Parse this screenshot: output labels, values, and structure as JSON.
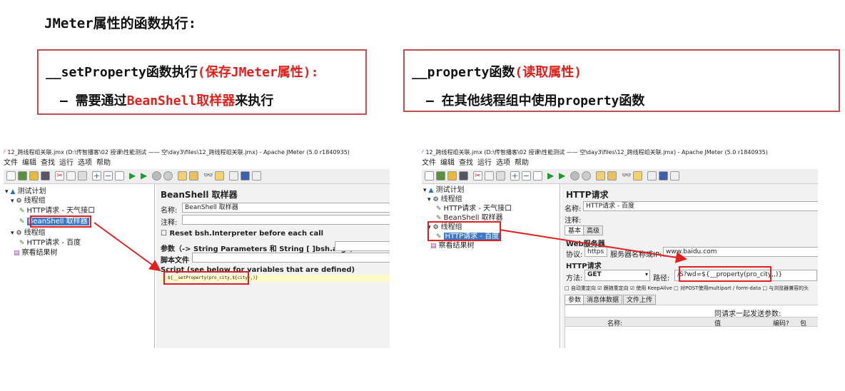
{
  "heading": "JMeter属性的函数执行:",
  "callout_left": {
    "line1_fn": "__setProperty函数执行",
    "line1_note": "(保存JMeter属性):",
    "line2_prefix": "— 需要通过",
    "line2_highlight": "BeanShell取样器",
    "line2_suffix": "来执行"
  },
  "callout_right": {
    "line1_fn": "__property函数",
    "line1_note": "(读取属性)",
    "line2": "— 在其他线程组中使用property函数"
  },
  "colors": {
    "callout_border": "#c0504d",
    "highlight_red": "#e0201b",
    "selection_blue": "#3c79c7"
  },
  "left_shot": {
    "title": "12_跨线程组关联.jmx (D:\\传智播客\\02 授课\\性能测试 —— 空\\day3\\files\\12_跨线程组关联.jmx) - Apache JMeter (5.0 r1840935)",
    "menu": [
      "文件",
      "编辑",
      "查找",
      "运行",
      "选项",
      "帮助"
    ],
    "tree": {
      "plan": "测试计划",
      "group1": "线程组",
      "http1": "HTTP请求 - 天气接口",
      "beanshell": "BeanShell 取样器",
      "group2": "线程组",
      "http2": "HTTP请求 - 百度",
      "listener": "察看结果树"
    },
    "panel": {
      "title": "BeanShell 取样器",
      "name_label": "名称:",
      "name_value": "BeanShell 取样器",
      "comment_label": "注释:",
      "reset_label": "Reset bsh.Interpreter before each call",
      "params_label": "参数（-> String Parameters 和 String [ ]bsh.args）",
      "script_file_label": "脚本文件",
      "script_label": "Script (see below for variables that are defined)",
      "script_code": "${__setProperty(pro_city,${city},)}"
    }
  },
  "right_shot": {
    "title": "12_跨线程组关联.jmx (D:\\传智播客\\02 授课\\性能测试 —— 空\\day3\\files\\12_跨线程组关联.jmx) - Apache JMeter (5.0 r1840935)",
    "menu": [
      "文件",
      "编辑",
      "查找",
      "运行",
      "选项",
      "帮助"
    ],
    "tree": {
      "plan": "测试计划",
      "group1": "线程组",
      "http1": "HTTP请求 - 天气接口",
      "beanshell": "BeanShell 取样器",
      "group2": "线程组",
      "http2": "HTTP请求 - 百度",
      "listener": "察看结果树"
    },
    "panel": {
      "title": "HTTP请求",
      "name_label": "名称:",
      "name_value": "HTTP请求 - 百度",
      "comment_label": "注释:",
      "tab_basic": "基本",
      "tab_advanced": "高级",
      "web_server": "Web服务器",
      "protocol_label": "协议:",
      "protocol_value": "https",
      "server_label": "服务器名称或IP:",
      "server_value": "www.baidu.com",
      "http_section": "HTTP请求",
      "method_label": "方法:",
      "method_value": "GET",
      "path_label": "路径:",
      "path_value": "/S?wd=${__property(pro_city,,)}",
      "options": "□ 自动重定向  ☑ 跟随重定向  ☑ 使用 KeepAlive  □ 对POST使用multipart / form-data  □ 与浏览器兼容的头",
      "subtab_params": "参数",
      "subtab_body": "消息体数据",
      "subtab_files": "文件上传",
      "send_with": "同请求一起发送参数:",
      "col_name": "名称:",
      "col_value": "值",
      "col_encode": "编码?",
      "col_include": "包"
    }
  }
}
